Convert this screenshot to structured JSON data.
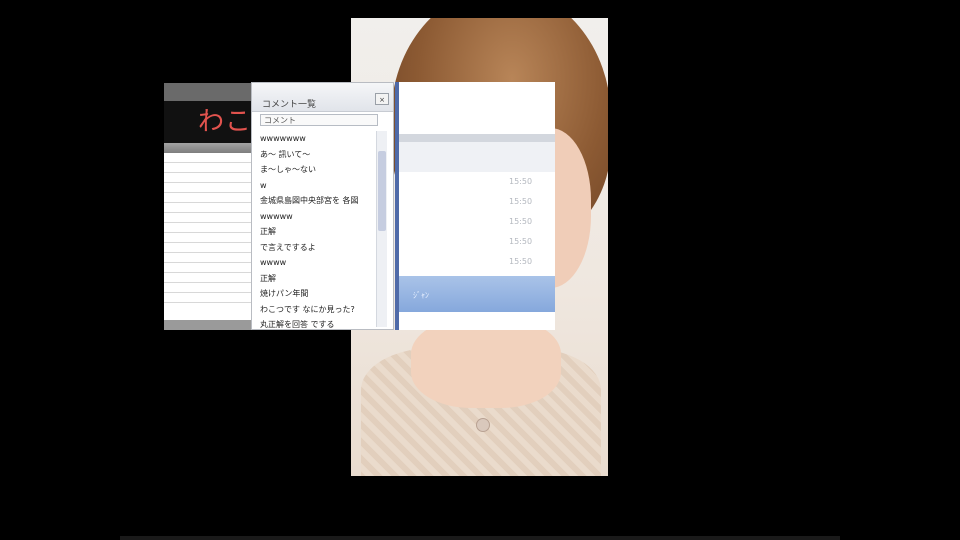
{
  "left_window": {
    "logo": "わこ"
  },
  "comment_window": {
    "title": "コメント一覧",
    "close_label": "×",
    "search_value": "コメント",
    "items": [
      "wwwwwww",
      "あ～ 訊いて～",
      "ま～しゃ～ない",
      "w",
      "金城県島図中央部宮を 各図",
      "wwwww",
      "正解",
      "で言えでするよ",
      "wwww",
      "正解",
      "焼けパン年間",
      "わこつです なにか見った?",
      "丸正解を回答 でする"
    ]
  },
  "right_panel": {
    "times": [
      "15:50",
      "15:50",
      "15:50",
      "15:50",
      "15:50"
    ],
    "blue_label": "ｼﾞｬﾝ"
  }
}
